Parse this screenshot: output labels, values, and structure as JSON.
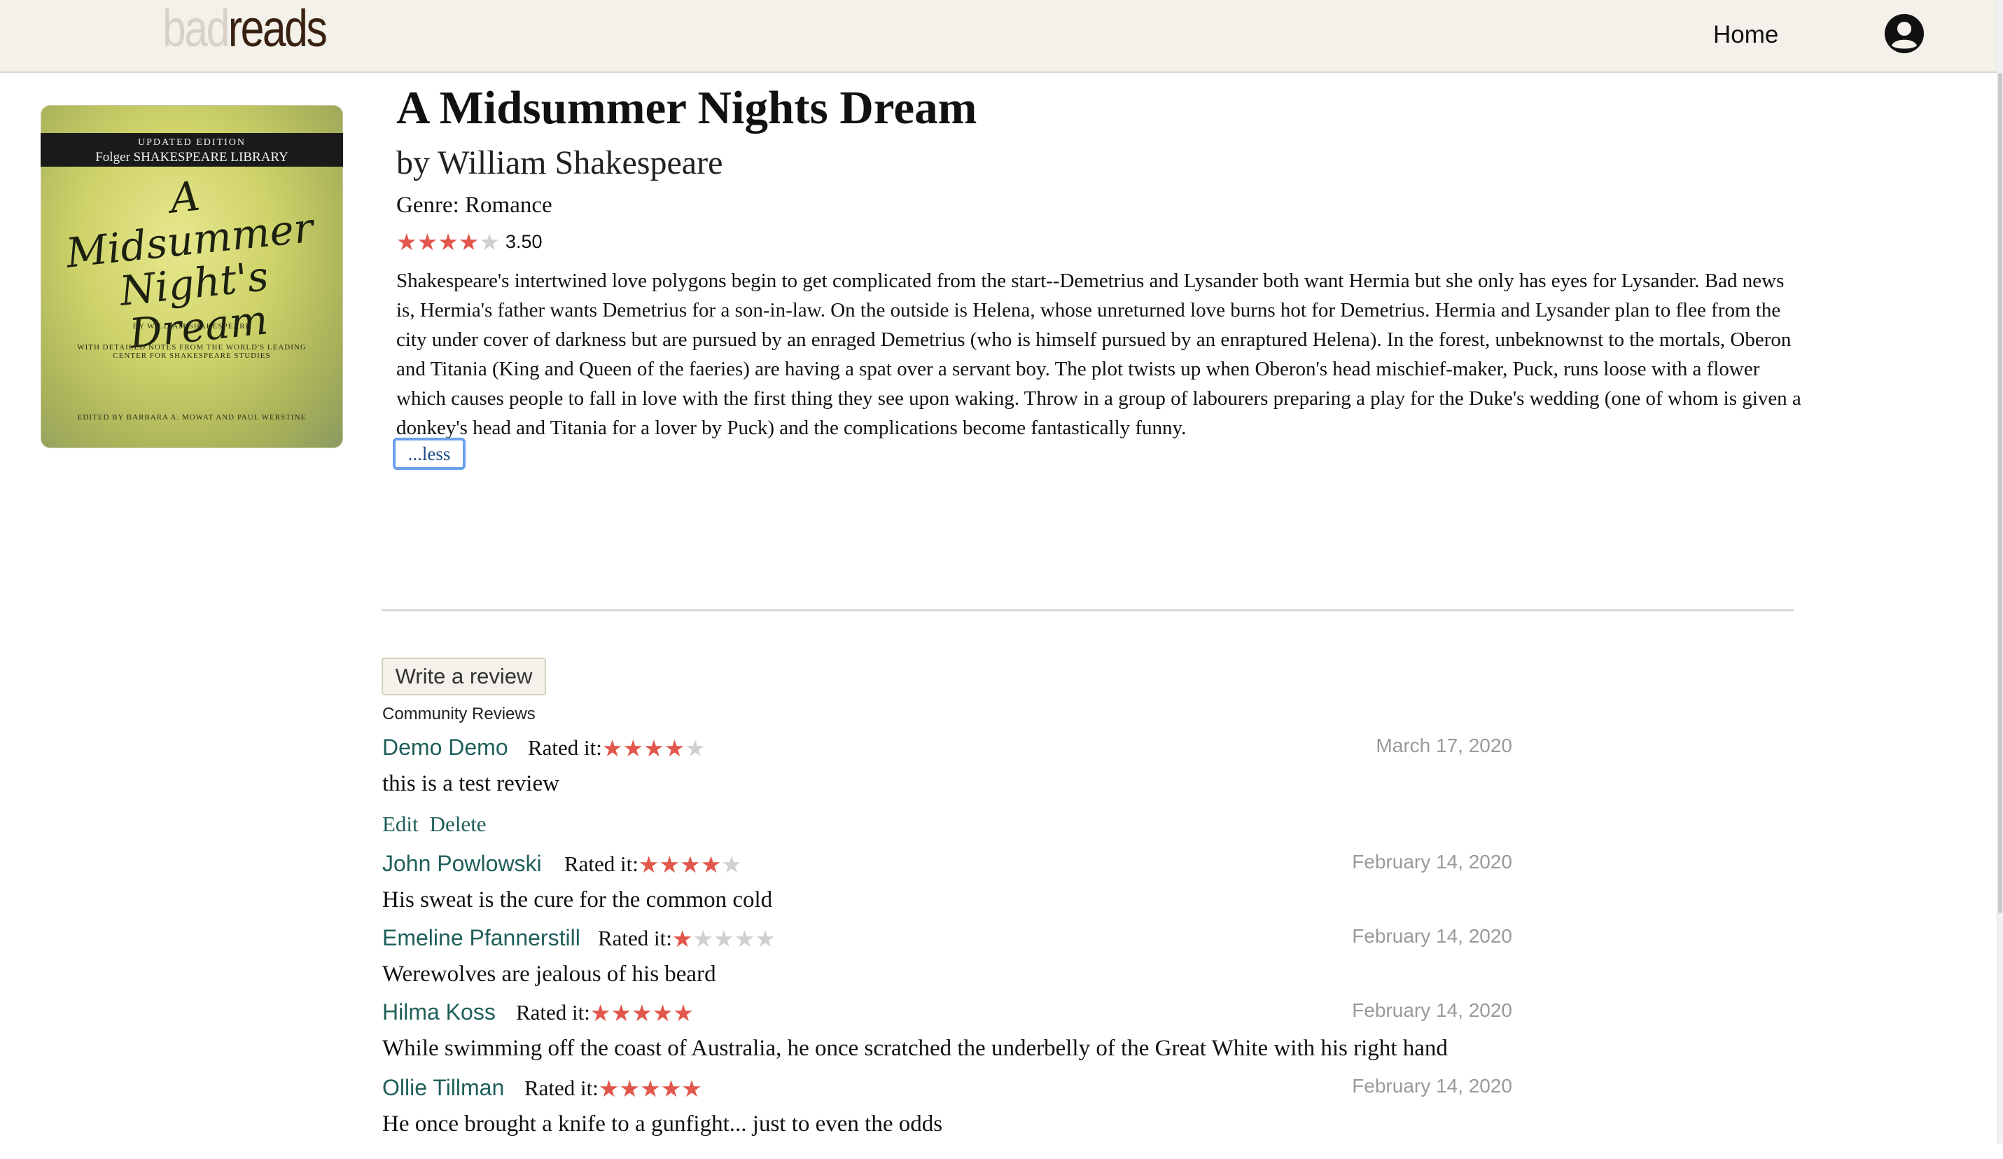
{
  "nav": {
    "logo_bad": "bad",
    "logo_reads": "reads",
    "home_label": "Home",
    "avatar_icon": "user-circle-icon"
  },
  "cover": {
    "edition": "UPDATED EDITION",
    "library": "Folger SHAKESPEARE LIBRARY",
    "title_line1": "A",
    "title_line2": "Midsummer",
    "title_line3": "Night's",
    "title_line4": "Dream",
    "by": "BY WILLIAM SHAKESPEARE",
    "notes": "WITH DETAILED NOTES FROM THE WORLD'S LEADING CENTER FOR SHAKESPEARE STUDIES",
    "editors": "EDITED BY BARBARA A. MOWAT AND PAUL WERSTINE"
  },
  "book": {
    "title": "A Midsummer Nights Dream",
    "author": "by William Shakespeare",
    "genre": "Genre: Romance",
    "rating_stars": 3.5,
    "rating_text": "3.50",
    "description": "Shakespeare's intertwined love polygons begin to get complicated from the start--Demetrius and Lysander both want Hermia but she only has eyes for Lysander. Bad news is, Hermia's father wants Demetrius for a son-in-law. On the outside is Helena, whose unreturned love burns hot for Demetrius. Hermia and Lysander plan to flee from the city under cover of darkness but are pursued by an enraged Demetrius (who is himself pursued by an enraptured Helena). In the forest, unbeknownst to the mortals, Oberon and Titania (King and Queen of the faeries) are having a spat over a servant boy. The plot twists up when Oberon's head mischief-maker, Puck, runs loose with a flower which causes people to fall in love with the first thing they see upon waking. Throw in a group of labourers preparing a play for the Duke's wedding (one of whom is given a donkey's head and Titania for a lover by Puck) and the complications become fantastically funny.",
    "less_label": "...less"
  },
  "reviews_section": {
    "write_label": "Write a review",
    "community_label": "Community Reviews",
    "rated_label": "Rated it:",
    "edit_label": "Edit",
    "delete_label": "Delete"
  },
  "reviews": [
    {
      "name": "Demo Demo",
      "stars": 4,
      "date": "March 17, 2020",
      "text": "this is a test review",
      "own": true
    },
    {
      "name": "John Powlowski",
      "stars": 4,
      "date": "February 14, 2020",
      "text": "His sweat is the cure for the common cold",
      "own": false
    },
    {
      "name": "Emeline Pfannerstill",
      "stars": 1,
      "date": "February 14, 2020",
      "text": "Werewolves are jealous of his beard",
      "own": false
    },
    {
      "name": "Hilma Koss",
      "stars": 5,
      "date": "February 14, 2020",
      "text": "While swimming off the coast of Australia, he once scratched the underbelly of the Great White with his right hand",
      "own": false
    },
    {
      "name": "Ollie Tillman",
      "stars": 5,
      "date": "February 14, 2020",
      "text": "He once brought a knife to a gunfight... just to even the odds",
      "own": false
    }
  ],
  "colors": {
    "star_on": "#e2574c",
    "star_off": "#d0d0d0",
    "link": "#1e5f5a",
    "nav_bg": "#f4f1ea"
  }
}
